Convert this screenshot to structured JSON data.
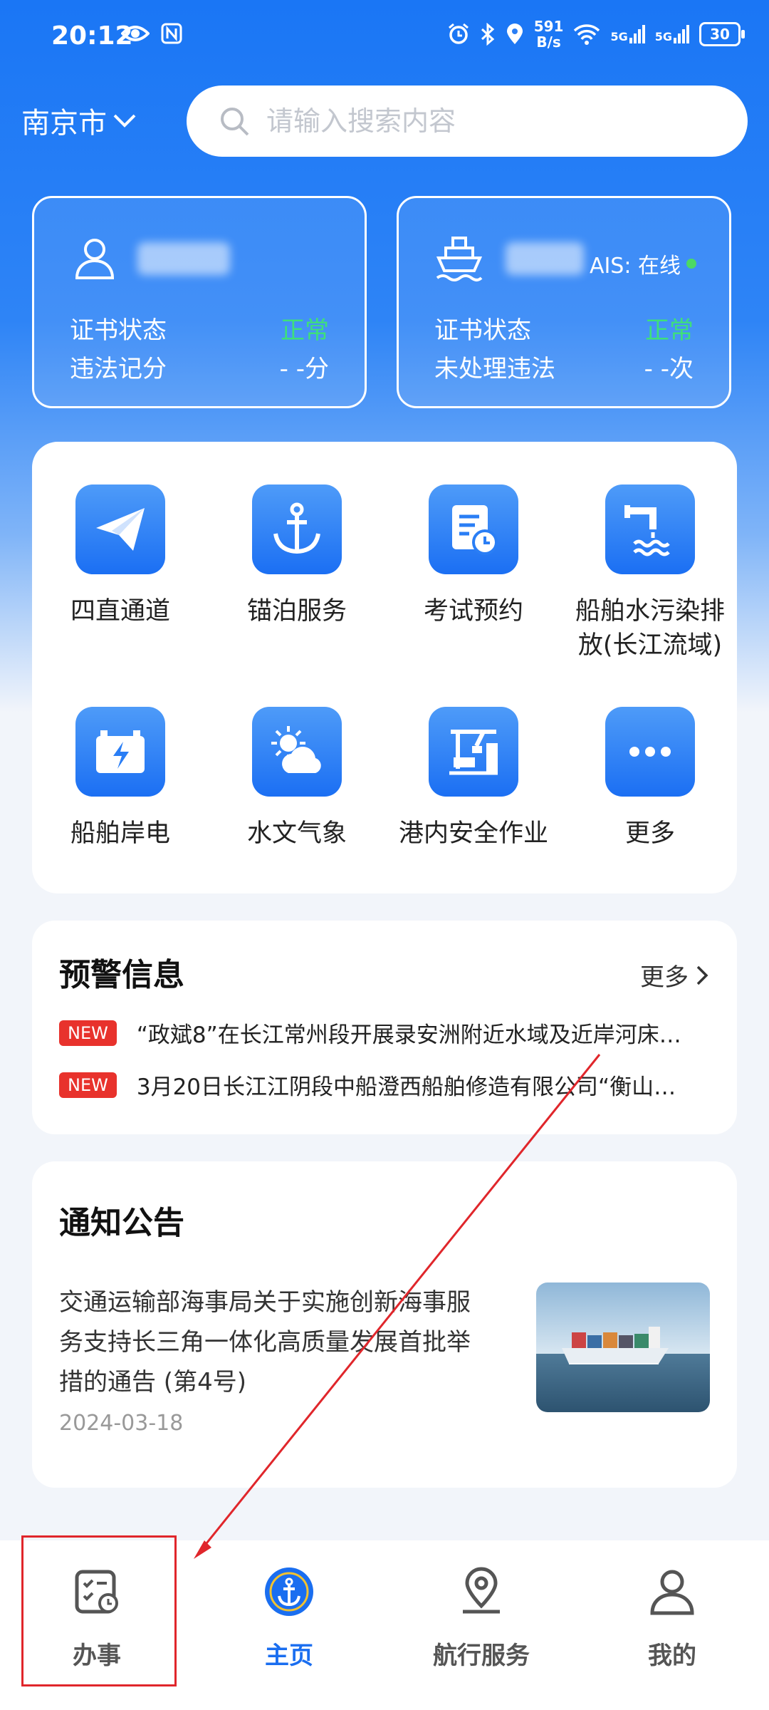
{
  "status_bar": {
    "time": "20:12",
    "net_speed_value": "591",
    "net_speed_unit": "B/s",
    "network_1": "5G",
    "network_2": "5G",
    "battery": "30",
    "icons": [
      "eye-icon",
      "nfc-icon",
      "alarm-icon",
      "bluetooth-icon",
      "location-icon",
      "wifi-icon",
      "signal-icon",
      "battery-icon"
    ]
  },
  "header": {
    "city": "南京市",
    "search_placeholder": "请输入搜索内容"
  },
  "person_card": {
    "label_cert": "证书状态",
    "cert_value": "正常",
    "label_points": "违法记分",
    "points_value": "- -分"
  },
  "ship_card": {
    "ais_label": "AIS: 在线",
    "label_cert": "证书状态",
    "cert_value": "正常",
    "label_violations": "未处理违法",
    "violations_value": "- -次"
  },
  "services": [
    {
      "label": "四直通道",
      "icon": "paper-plane-icon"
    },
    {
      "label": "锚泊服务",
      "icon": "anchor-icon"
    },
    {
      "label": "考试预约",
      "icon": "document-clock-icon"
    },
    {
      "label_line1": "船舶水污染排",
      "label_line2": "放(长江流域)",
      "icon": "pipe-water-icon"
    },
    {
      "label": "船舶岸电",
      "icon": "battery-charge-icon"
    },
    {
      "label": "水文气象",
      "icon": "sun-cloud-icon"
    },
    {
      "label": "港内安全作业",
      "icon": "crane-icon"
    },
    {
      "label": "更多",
      "icon": "more-dots-icon"
    }
  ],
  "warnings": {
    "title": "预警信息",
    "more": "更多",
    "items": [
      {
        "badge": "NEW",
        "text": "“政斌8”在长江常州段开展录安洲附近水域及近岸河床…"
      },
      {
        "badge": "NEW",
        "text": "3月20日长江江阴段中船澄西船舶修造有限公司“衡山…"
      }
    ]
  },
  "notices": {
    "title": "通知公告",
    "item_text": "交通运输部海事局关于实施创新海事服务支持长三角一体化高质量发展首批举措的通告 (第4号)",
    "item_date": "2024-03-18"
  },
  "bottom_nav": [
    {
      "label": "办事",
      "icon": "task-list-icon",
      "active": false
    },
    {
      "label": "主页",
      "icon": "maritime-emblem-icon",
      "active": true
    },
    {
      "label": "航行服务",
      "icon": "map-pin-icon",
      "active": false
    },
    {
      "label": "我的",
      "icon": "user-icon",
      "active": false
    }
  ],
  "colors": {
    "brand_blue": "#1a76f5",
    "active_nav": "#1a6ef0",
    "status_green": "#3ee07a",
    "badge_red": "#e8322c",
    "annotation_red": "#e0262b"
  }
}
